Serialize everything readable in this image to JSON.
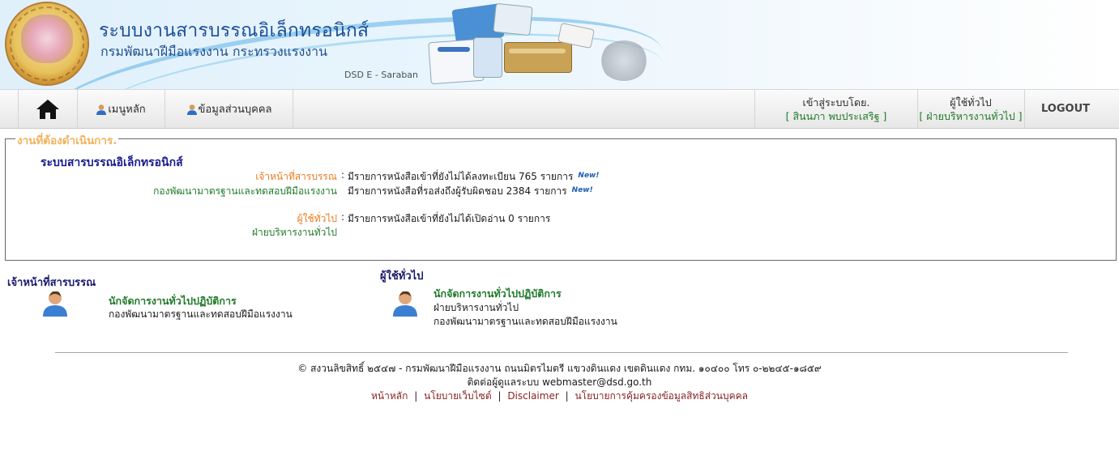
{
  "header": {
    "title": "ระบบงานสารบรรณอิเล็กทรอนิกส์",
    "subtitle": "กรมพัฒนาฝีมือแรงงาน กระทรวงแรงงาน",
    "system_code": "DSD E - Saraban",
    "logo_text": "กรมพัฒนาฝีมือแรงงาน"
  },
  "nav": {
    "home_icon": "home-icon",
    "main_menu": "เมนูหลัก",
    "personal_info": "ข้อมูลส่วนบุคคล",
    "login_label": "เข้าสู่ระบบโดย.",
    "login_user": "[ สินนภา พบประเสริฐ ]",
    "role_label": "ผู้ใช้ทั่วไป",
    "role_unit": "[ ฝ่ายบริหารงานทั่วไป ]",
    "logout": "LOGOUT"
  },
  "tasks": {
    "legend": "งานที่ต้องดำเนินการ.",
    "heading": "ระบบสารบรรณอิเล็กทรอนิกส์",
    "items": [
      {
        "role": "เจ้าหน้าที่สารบรรณ",
        "message": "มีรายการหนังสือเข้าที่ยังไม่ได้ลงทะเบียน 765 รายการ",
        "badge": "New!"
      },
      {
        "role": "กองพัฒนามาตรฐานและทดสอบฝีมือแรงงาน",
        "message": "มีรายการหนังสือที่รอส่งถึงผู้รับผิดชอบ 2384 รายการ",
        "badge": "New!"
      },
      {
        "role": "ผู้ใช้ทั่วไป",
        "message": "มีรายการหนังสือเข้าที่ยังไม่ได้เปิดอ่าน 0 รายการ"
      },
      {
        "role": "ฝ่ายบริหารงานทั่วไป"
      }
    ]
  },
  "people": {
    "left": {
      "section_title": "เจ้าหน้าที่สารบรรณ",
      "name": "นักจัดการงานทั่วไปปฏิบัติการ",
      "lines": [
        "กองพัฒนามาตรฐานและทดสอบฝีมือแรงงาน"
      ]
    },
    "right": {
      "section_title": "ผู้ใช้ทั่วไป",
      "name": "นักจัดการงานทั่วไปปฏิบัติการ",
      "lines": [
        "ฝ่ายบริหารงานทั่วไป",
        "กองพัฒนามาตรฐานและทดสอบฝีมือแรงงาน"
      ]
    }
  },
  "footer": {
    "copyright": "©  สงวนลิขสิทธิ์ ๒๕๔๗ - กรมพัฒนาฝีมือแรงงาน ถนนมิตรไมตรี แขวงดินแดง เขตดินแดง กทม. ๑๐๔๐๐ โทร ๐-๒๒๔๕-๑๘๕๙",
    "contact": "ติดต่อผู้ดูแลระบบ webmaster@dsd.go.th",
    "links": [
      "หน้าหลัก",
      "นโยบายเว็บไซต์",
      "Disclaimer",
      "นโยบายการคุ้มครองข้อมูลสิทธิส่วนบุคคล"
    ],
    "separator": "|"
  }
}
